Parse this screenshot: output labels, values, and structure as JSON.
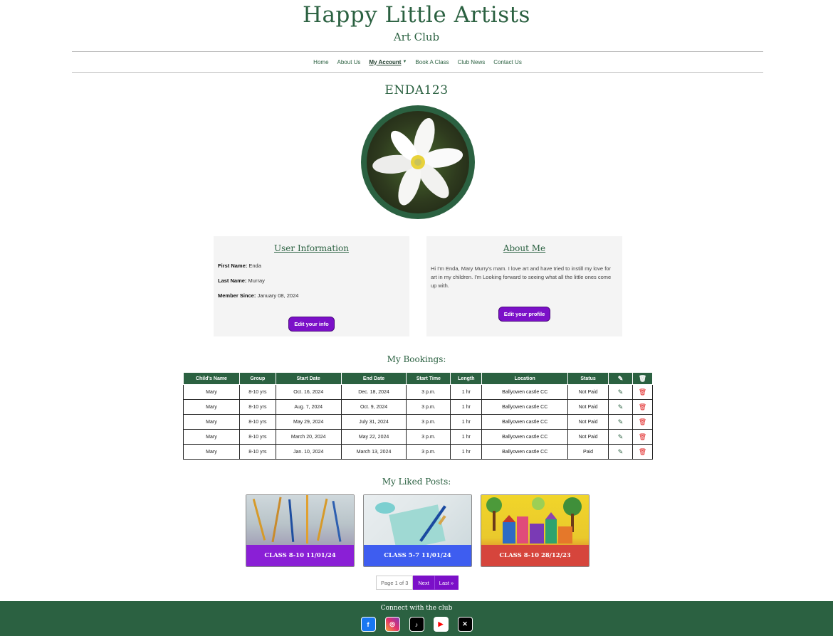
{
  "header": {
    "title": "Happy Little Artists",
    "subtitle": "Art Club"
  },
  "nav": {
    "items": [
      {
        "label": "Home"
      },
      {
        "label": "About Us"
      },
      {
        "label": "My Account"
      },
      {
        "label": "Book A Class"
      },
      {
        "label": "Club News"
      },
      {
        "label": "Contact Us"
      }
    ]
  },
  "profile": {
    "username": "ENDA123"
  },
  "user_info": {
    "title": "User Information",
    "first_name_label": "First Name:",
    "first_name": "Enda",
    "last_name_label": "Last Name:",
    "last_name": "Murray",
    "member_since_label": "Member Since:",
    "member_since": "January 08, 2024",
    "edit_button": "Edit your info"
  },
  "about_me": {
    "title": "About Me",
    "text": "Hi I'm Enda, Mary Murry's mam. I love art and have tried to instill my love for art in my children. I'm Looking forward to seeing what all the little ones come up with.",
    "edit_button": "Edit your profile"
  },
  "bookings": {
    "title": "My Bookings:",
    "headers": [
      "Child's Name",
      "Group",
      "Start Date",
      "End Date",
      "Start Time",
      "Length",
      "Location",
      "Status"
    ],
    "rows": [
      [
        "Mary",
        "8-10 yrs",
        "Oct. 16, 2024",
        "Dec. 18, 2024",
        "3 p.m.",
        "1 hr",
        "Ballyowen castle CC",
        "Not Paid"
      ],
      [
        "Mary",
        "8-10 yrs",
        "Aug. 7, 2024",
        "Oct. 9, 2024",
        "3 p.m.",
        "1 hr",
        "Ballyowen castle CC",
        "Not Paid"
      ],
      [
        "Mary",
        "8-10 yrs",
        "May 29, 2024",
        "July 31, 2024",
        "3 p.m.",
        "1 hr",
        "Ballyowen castle CC",
        "Not Paid"
      ],
      [
        "Mary",
        "8-10 yrs",
        "March 20, 2024",
        "May 22, 2024",
        "3 p.m.",
        "1 hr",
        "Ballyowen castle CC",
        "Not Paid"
      ],
      [
        "Mary",
        "8-10 yrs",
        "Jan. 10, 2024",
        "March 13, 2024",
        "3 p.m.",
        "1 hr",
        "Ballyowen castle CC",
        "Paid"
      ]
    ]
  },
  "liked_posts": {
    "title": "My Liked Posts:",
    "posts": [
      {
        "label": "CLASS 8-10 11/01/24",
        "color": "#8a1fd6"
      },
      {
        "label": "CLASS 5-7 11/01/24",
        "color": "#3e5df0"
      },
      {
        "label": "CLASS 8-10 28/12/23",
        "color": "#d6453c"
      }
    ]
  },
  "pagination": {
    "current": "Page 1 of 3",
    "next": "Next",
    "last": "Last »"
  },
  "footer": {
    "title": "Connect with the club",
    "icons": [
      "facebook-icon",
      "instagram-icon",
      "tiktok-icon",
      "youtube-icon",
      "x-icon"
    ]
  },
  "colors": {
    "brand_green": "#2b6141",
    "accent_purple": "#7b10c8",
    "delete_red": "#e02424"
  }
}
